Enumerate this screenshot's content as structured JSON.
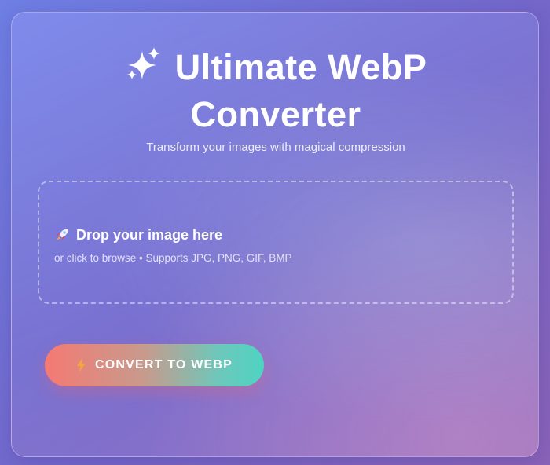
{
  "header": {
    "title_line1": "Ultimate WebP",
    "title_line2": "Converter",
    "title_icon": "sparkles-icon",
    "subtitle": "Transform your images with magical compression"
  },
  "dropzone": {
    "icon": "rocket-icon",
    "title": "Drop your image here",
    "hint": "or click to browse • Supports JPG, PNG, GIF, BMP"
  },
  "actions": {
    "convert_icon": "lightning-bolt-icon",
    "convert_label": "CONVERT TO WEBP"
  },
  "colors": {
    "background_start": "#6f7fe4",
    "background_end": "#8a63b8",
    "button_gradient_start": "#f47a73",
    "button_gradient_end": "#4fd3c2",
    "text": "#ffffff"
  }
}
